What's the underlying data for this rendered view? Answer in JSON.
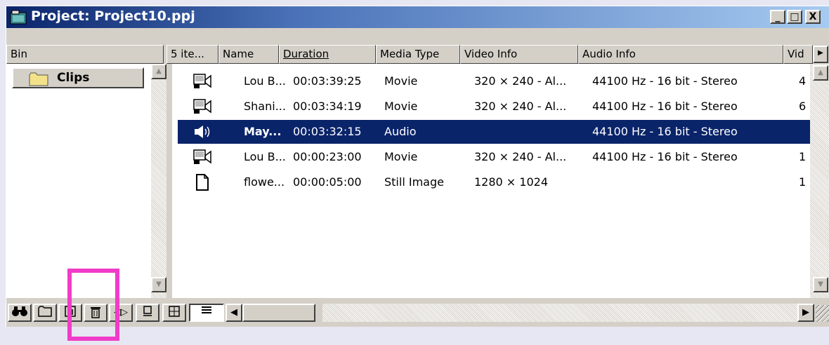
{
  "window": {
    "title": "Project: Project10.ppj",
    "minimize": "_",
    "maximize": "□",
    "close": "X"
  },
  "bin_panel": {
    "header": "Bin",
    "folder_label": "Clips"
  },
  "columns": {
    "count": "5 ite...",
    "name": "Name",
    "duration": "Duration",
    "media_type": "Media Type",
    "video_info": "Video Info",
    "audio_info": "Audio Info",
    "extra": "Vid"
  },
  "rows": [
    {
      "icon": "movie-icon",
      "name": "Lou B...",
      "duration": "00:03:39:25",
      "media_type": "Movie",
      "video_info": "320 × 240 - Al...",
      "audio_info": "44100 Hz - 16 bit - Stereo",
      "extra": "4"
    },
    {
      "icon": "movie-icon",
      "name": "Shani...",
      "duration": "00:03:34:19",
      "media_type": "Movie",
      "video_info": "320 × 240 - Al...",
      "audio_info": "44100 Hz - 16 bit - Stereo",
      "extra": "6"
    },
    {
      "icon": "audio-icon",
      "name": "May...",
      "duration": "00:03:32:15",
      "media_type": "Audio",
      "video_info": "",
      "audio_info": "44100 Hz - 16 bit - Stereo",
      "extra": ""
    },
    {
      "icon": "movie-icon",
      "name": "Lou B...",
      "duration": "00:00:23:00",
      "media_type": "Movie",
      "video_info": "320 × 240 - Al...",
      "audio_info": "44100 Hz - 16 bit - Stereo",
      "extra": "1"
    },
    {
      "icon": "still-image-icon",
      "name": "flowe...",
      "duration": "00:00:05:00",
      "media_type": "Still Image",
      "video_info": "1280 × 1024",
      "audio_info": "",
      "extra": "1"
    }
  ],
  "selected_row": 2,
  "toolbar": {
    "find_glyph": "🔍",
    "new_bin_glyph": "▭",
    "new_item_glyph": "◱",
    "delete_glyph": "🗑",
    "resize_glyph": "◁▷",
    "icon_view_glyph": "⊒",
    "thumb_view_glyph": "⊞",
    "list_view_glyph": "≣",
    "scroll_left": "◀",
    "scroll_right": "▶"
  },
  "colors": {
    "selection": "#0a246a",
    "highlight_box": "#f03cc8"
  }
}
